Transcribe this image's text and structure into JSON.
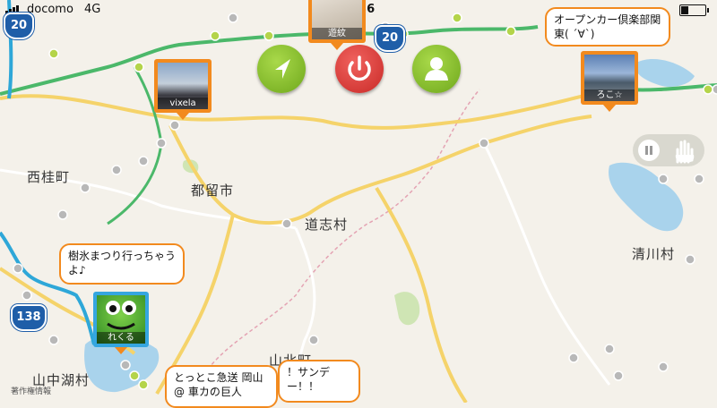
{
  "status_bar": {
    "carrier": "docomo",
    "network": "4G",
    "time": "9:36"
  },
  "map": {
    "places": {
      "nishikatsura": "西桂町",
      "tsuru": "都留市",
      "doshi": "道志村",
      "kiyokawa": "清川村",
      "yamanakako": "山中湖村",
      "yamakita": "山北町"
    },
    "route_shields": [
      "20",
      "20",
      "138"
    ],
    "copyright": "著作権情報"
  },
  "controls": {
    "navigate_icon": "navigation-arrow-icon",
    "power_icon": "power-icon",
    "profile_icon": "person-icon"
  },
  "pins": [
    {
      "caption": "遊紋"
    },
    {
      "caption": "vixela"
    },
    {
      "caption": "ろこ☆"
    },
    {
      "caption": "れくる"
    }
  ],
  "bubbles": {
    "open_car": "オープンカー倶楽部関東( ´∀`)",
    "juhyo": "樹氷まつり行っちゃうよ♪",
    "tottoko": "とっとこ急送 岡山@ 車カの巨人",
    "sunday": "！サンデー！！"
  },
  "colors": {
    "map_bg": "#f4f1ea",
    "pin_orange": "#f28a1e",
    "road_yellow": "#f5d36a",
    "road_green": "#4bb86a",
    "route_blue": "#1f5ea8",
    "water_blue": "#a9d3ec",
    "green_button": "#8cc23a",
    "red_button": "#d9352f"
  }
}
